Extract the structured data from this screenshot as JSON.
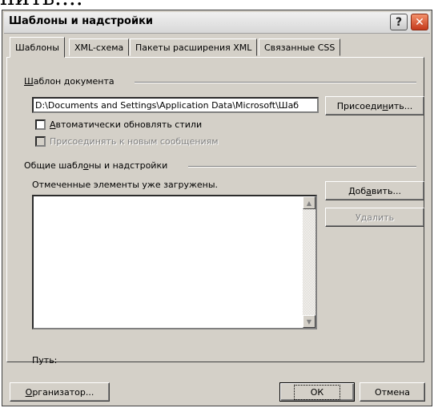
{
  "overlay": {
    "top_text": "нить...."
  },
  "window": {
    "title": "Шаблоны и надстройки",
    "help_glyph": "?",
    "close_glyph": "✕"
  },
  "tabs": [
    {
      "label": "Шаблоны",
      "active": true
    },
    {
      "label": "XML-схема",
      "active": false
    },
    {
      "label": "Пакеты расширения XML",
      "active": false
    },
    {
      "label": "Связанные CSS",
      "active": false
    }
  ],
  "document_template": {
    "group_label_u": "Ш",
    "group_label_rest": "аблон документа",
    "path_value": "D:\\Documents and Settings\\Application Data\\Microsoft\\Шаб",
    "attach_button_pre": "Присоеди",
    "attach_button_u": "н",
    "attach_button_post": "ить...",
    "auto_update_u": "А",
    "auto_update_rest": "втоматически обновлять стили",
    "attach_new_label": "Присоединять к новым сообщениям"
  },
  "global": {
    "group_label_pre": "Общие шабл",
    "group_label_u": "о",
    "group_label_post": "ны и надстройки",
    "list_caption": "Отмеченные элементы уже загружены.",
    "add_button_pre": "Доб",
    "add_button_u": "а",
    "add_button_post": "вить...",
    "remove_button": "Удалить",
    "path_label": "Путь:",
    "scroll_up_glyph": "▲",
    "scroll_down_glyph": "▼"
  },
  "footer": {
    "organizer_u": "О",
    "organizer_rest": "рганизатор...",
    "ok": "ОК",
    "cancel": "Отмена"
  },
  "colors": {
    "face": "#d4d0c8",
    "close_button": "#c4391c",
    "disabled_text": "#808080"
  }
}
